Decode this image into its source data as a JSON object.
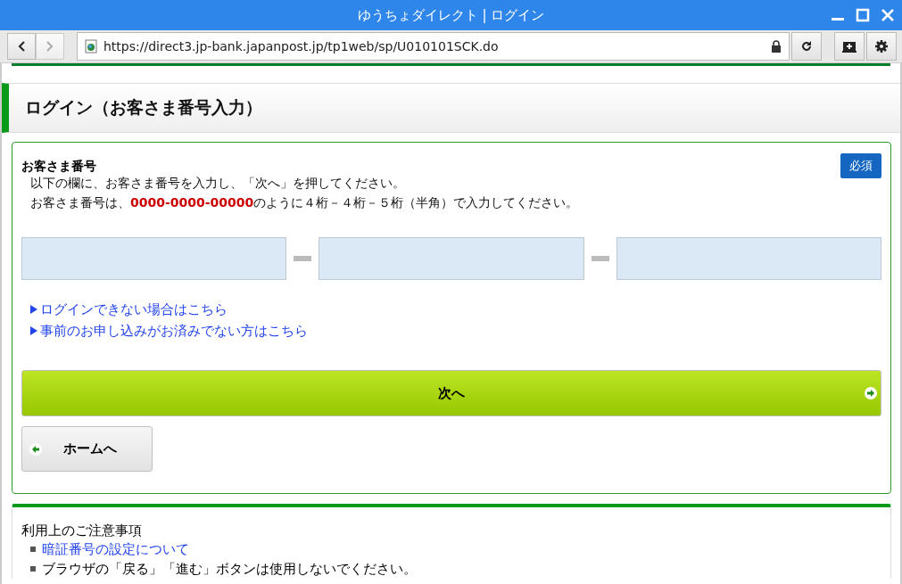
{
  "window": {
    "title": "ゆうちょダイレクト | ログイン"
  },
  "browser": {
    "nav": [
      {
        "kind": "back",
        "disabled": false
      },
      {
        "kind": "forward",
        "disabled": true
      }
    ],
    "url": "https://direct3.jp-bank.japanpost.jp/tp1web/sp/U010101SCK.do",
    "secure": true
  },
  "page": {
    "heading": "ログイン（お客さま番号入力）",
    "form": {
      "label": "お客さま番号",
      "required": "必須",
      "instructions": [
        "以下の欄に、お客さま番号を入力し、「次へ」を押してください。",
        "お客さま番号は、**0000-0000-00000**のように４桁－４桁－５桁（半角）で入力してください。"
      ],
      "fields": [
        {
          "kind": "text"
        },
        {
          "kind": "text"
        },
        {
          "kind": "text"
        }
      ],
      "links": [
        "ログインできない場合はこちら",
        "事前のお申し込みがお済みでない方はこちら"
      ],
      "buttons": [
        {
          "kind": "next",
          "label": "次へ"
        },
        {
          "kind": "home",
          "label": "ホームへ"
        }
      ]
    },
    "notices": {
      "title": "利用上のご注意事項",
      "items": [
        {
          "kind": "link",
          "text": "暗証番号の設定について"
        },
        {
          "kind": "text",
          "text": "ブラウザの「戻る」「進む」ボタンは使用しないでください。"
        }
      ]
    }
  }
}
